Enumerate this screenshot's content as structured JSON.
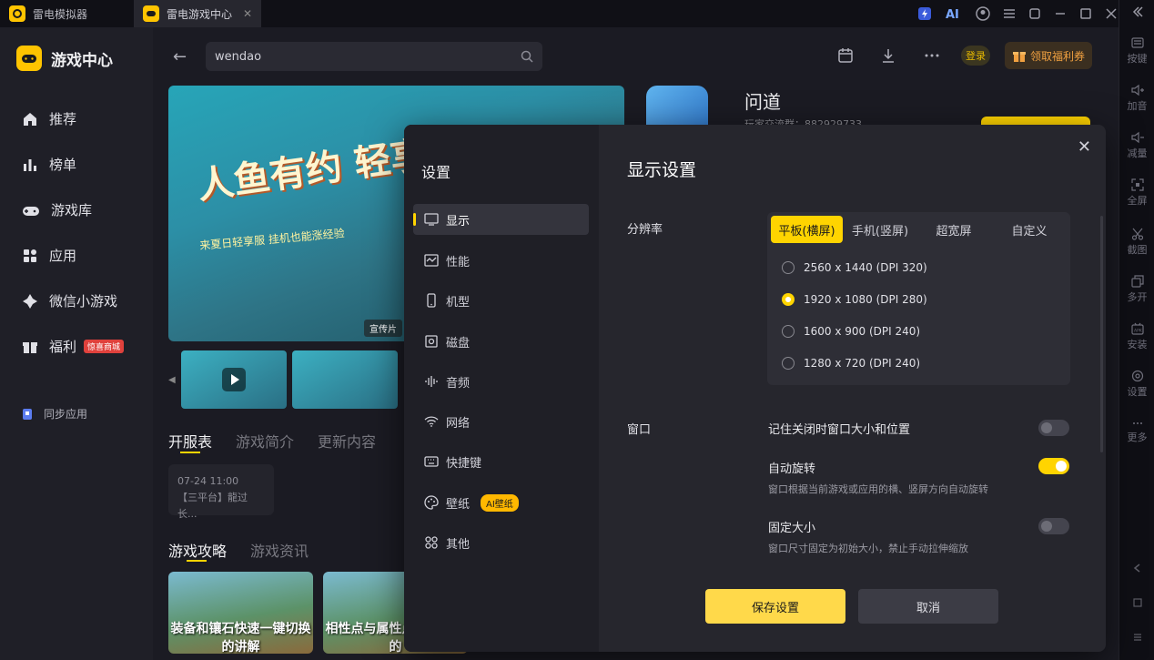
{
  "titlebar": {
    "tab1": "雷电模拟器",
    "tab2": "雷电游戏中心",
    "tab_close": "✕"
  },
  "sidebar": {
    "brand": "游戏中心",
    "items": [
      {
        "label": "推荐",
        "icon": "home-icon"
      },
      {
        "label": "榜单",
        "icon": "chart-icon"
      },
      {
        "label": "游戏库",
        "icon": "gamepad-icon"
      },
      {
        "label": "应用",
        "icon": "apps-icon"
      },
      {
        "label": "微信小游戏",
        "icon": "mini-game-icon"
      },
      {
        "label": "福利",
        "icon": "gift-icon",
        "badge": "惊喜商城"
      }
    ],
    "sync": "同步应用"
  },
  "header": {
    "search_value": "wendao",
    "login": "登录",
    "coupon": "领取福利券"
  },
  "banner": {
    "title": "人鱼有约 轻享夏日",
    "subtitle": "来夏日轻享服 挂机也能涨经验",
    "promo_tag": "宣传片"
  },
  "content": {
    "tabs1": [
      "开服表",
      "游戏简介",
      "更新内容"
    ],
    "server_time": "07-24 11:00",
    "server_name": "【三平台】龍过长...",
    "tabs2": [
      "游戏攻略",
      "游戏资讯"
    ],
    "guide_cards": [
      "装备和镶石快速一键切换的讲解",
      "相性点与属性点分板影响的"
    ]
  },
  "app": {
    "name": "问道",
    "sub": "玩家交流群：882929733"
  },
  "right_strip": [
    {
      "label": "按键",
      "icon": "keyboard-icon"
    },
    {
      "label": "加音",
      "icon": "volume-up-icon"
    },
    {
      "label": "减量",
      "icon": "volume-down-icon"
    },
    {
      "label": "全屏",
      "icon": "fullscreen-icon"
    },
    {
      "label": "截图",
      "icon": "scissors-icon"
    },
    {
      "label": "多开",
      "icon": "multi-instance-icon"
    },
    {
      "label": "安装",
      "icon": "apk-install-icon"
    },
    {
      "label": "设置",
      "icon": "settings-icon"
    },
    {
      "label": "更多",
      "icon": "more-icon"
    }
  ],
  "dialog": {
    "title": "设置",
    "heading": "显示设置",
    "menu": [
      {
        "label": "显示",
        "icon": "monitor-icon"
      },
      {
        "label": "性能",
        "icon": "performance-icon"
      },
      {
        "label": "机型",
        "icon": "phone-icon"
      },
      {
        "label": "磁盘",
        "icon": "disk-icon"
      },
      {
        "label": "音频",
        "icon": "audio-icon"
      },
      {
        "label": "网络",
        "icon": "wifi-icon"
      },
      {
        "label": "快捷键",
        "icon": "keyboard-icon"
      },
      {
        "label": "壁纸",
        "icon": "palette-icon",
        "badge": "AI壁纸"
      },
      {
        "label": "其他",
        "icon": "grid-icon"
      }
    ],
    "resolution_label": "分辨率",
    "segments": [
      "平板(横屏)",
      "手机(竖屏)",
      "超宽屏",
      "自定义"
    ],
    "resolutions": [
      {
        "label": "2560 x 1440  (DPI 320)",
        "selected": false
      },
      {
        "label": "1920 x 1080  (DPI 280)",
        "selected": true
      },
      {
        "label": "1600 x 900  (DPI 240)",
        "selected": false
      },
      {
        "label": "1280 x 720  (DPI 240)",
        "selected": false
      }
    ],
    "window_label": "窗口",
    "options": [
      {
        "title": "记住关闭时窗口大小和位置",
        "desc": "",
        "on": false
      },
      {
        "title": "自动旋转",
        "desc": "窗口根据当前游戏或应用的横、竖屏方向自动旋转",
        "on": true
      },
      {
        "title": "固定大小",
        "desc": "窗口尺寸固定为初始大小，禁止手动拉伸缩放",
        "on": false
      }
    ],
    "save": "保存设置",
    "cancel": "取消"
  }
}
